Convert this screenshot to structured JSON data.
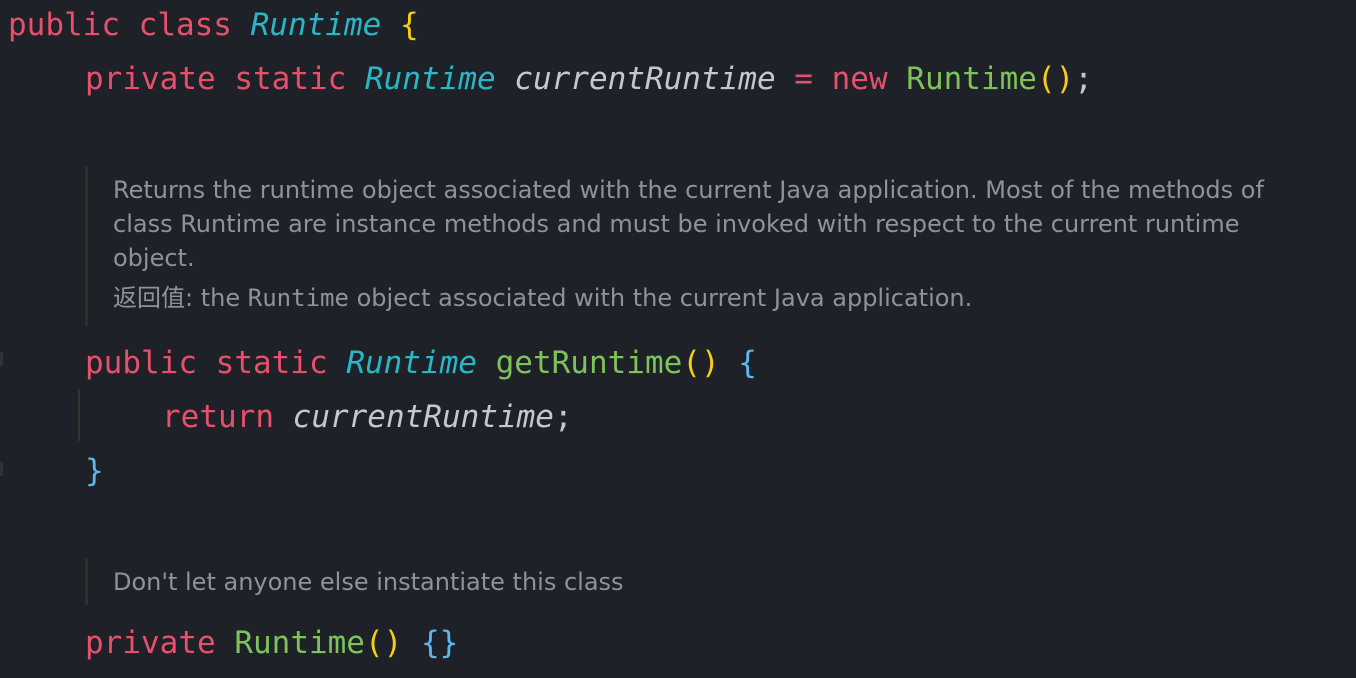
{
  "code": {
    "class_decl": {
      "kw_public": "public",
      "kw_class": "class",
      "class_name": "Runtime",
      "open_brace": "{"
    },
    "field_decl": {
      "kw_private": "private",
      "kw_static": "static",
      "type": "Runtime",
      "name": "currentRuntime",
      "assign": "=",
      "kw_new": "new",
      "ctor": "Runtime",
      "parens": "()",
      "semicolon": ";"
    },
    "doc_get_runtime": {
      "lines": [
        "Returns the runtime object associated with the current Java application. Most of the methods of",
        "class Runtime are instance methods and must be invoked with respect to the current runtime",
        "object."
      ],
      "return_label": "返回值:",
      "return_pre": "the",
      "return_code": "Runtime",
      "return_post": "object associated with the current Java application."
    },
    "method_decl": {
      "kw_public": "public",
      "kw_static": "static",
      "return_type": "Runtime",
      "name": "getRuntime",
      "parens": "()",
      "open_brace": "{"
    },
    "return_stmt": {
      "kw_return": "return",
      "value": "currentRuntime",
      "semicolon": ";"
    },
    "method_close": "}",
    "doc_ctor": {
      "text": "Don't let anyone else instantiate this class"
    },
    "ctor_decl": {
      "kw_private": "private",
      "name": "Runtime",
      "parens": "()",
      "braces": "{}"
    }
  },
  "colors": {
    "background": "#1e2128",
    "keyword": "#e84f6a",
    "type": "#2ab7c5",
    "method": "#7ec35a",
    "paren": "#f6cf14",
    "brace": "#5cb8ef",
    "doc_text": "#8d929c"
  }
}
